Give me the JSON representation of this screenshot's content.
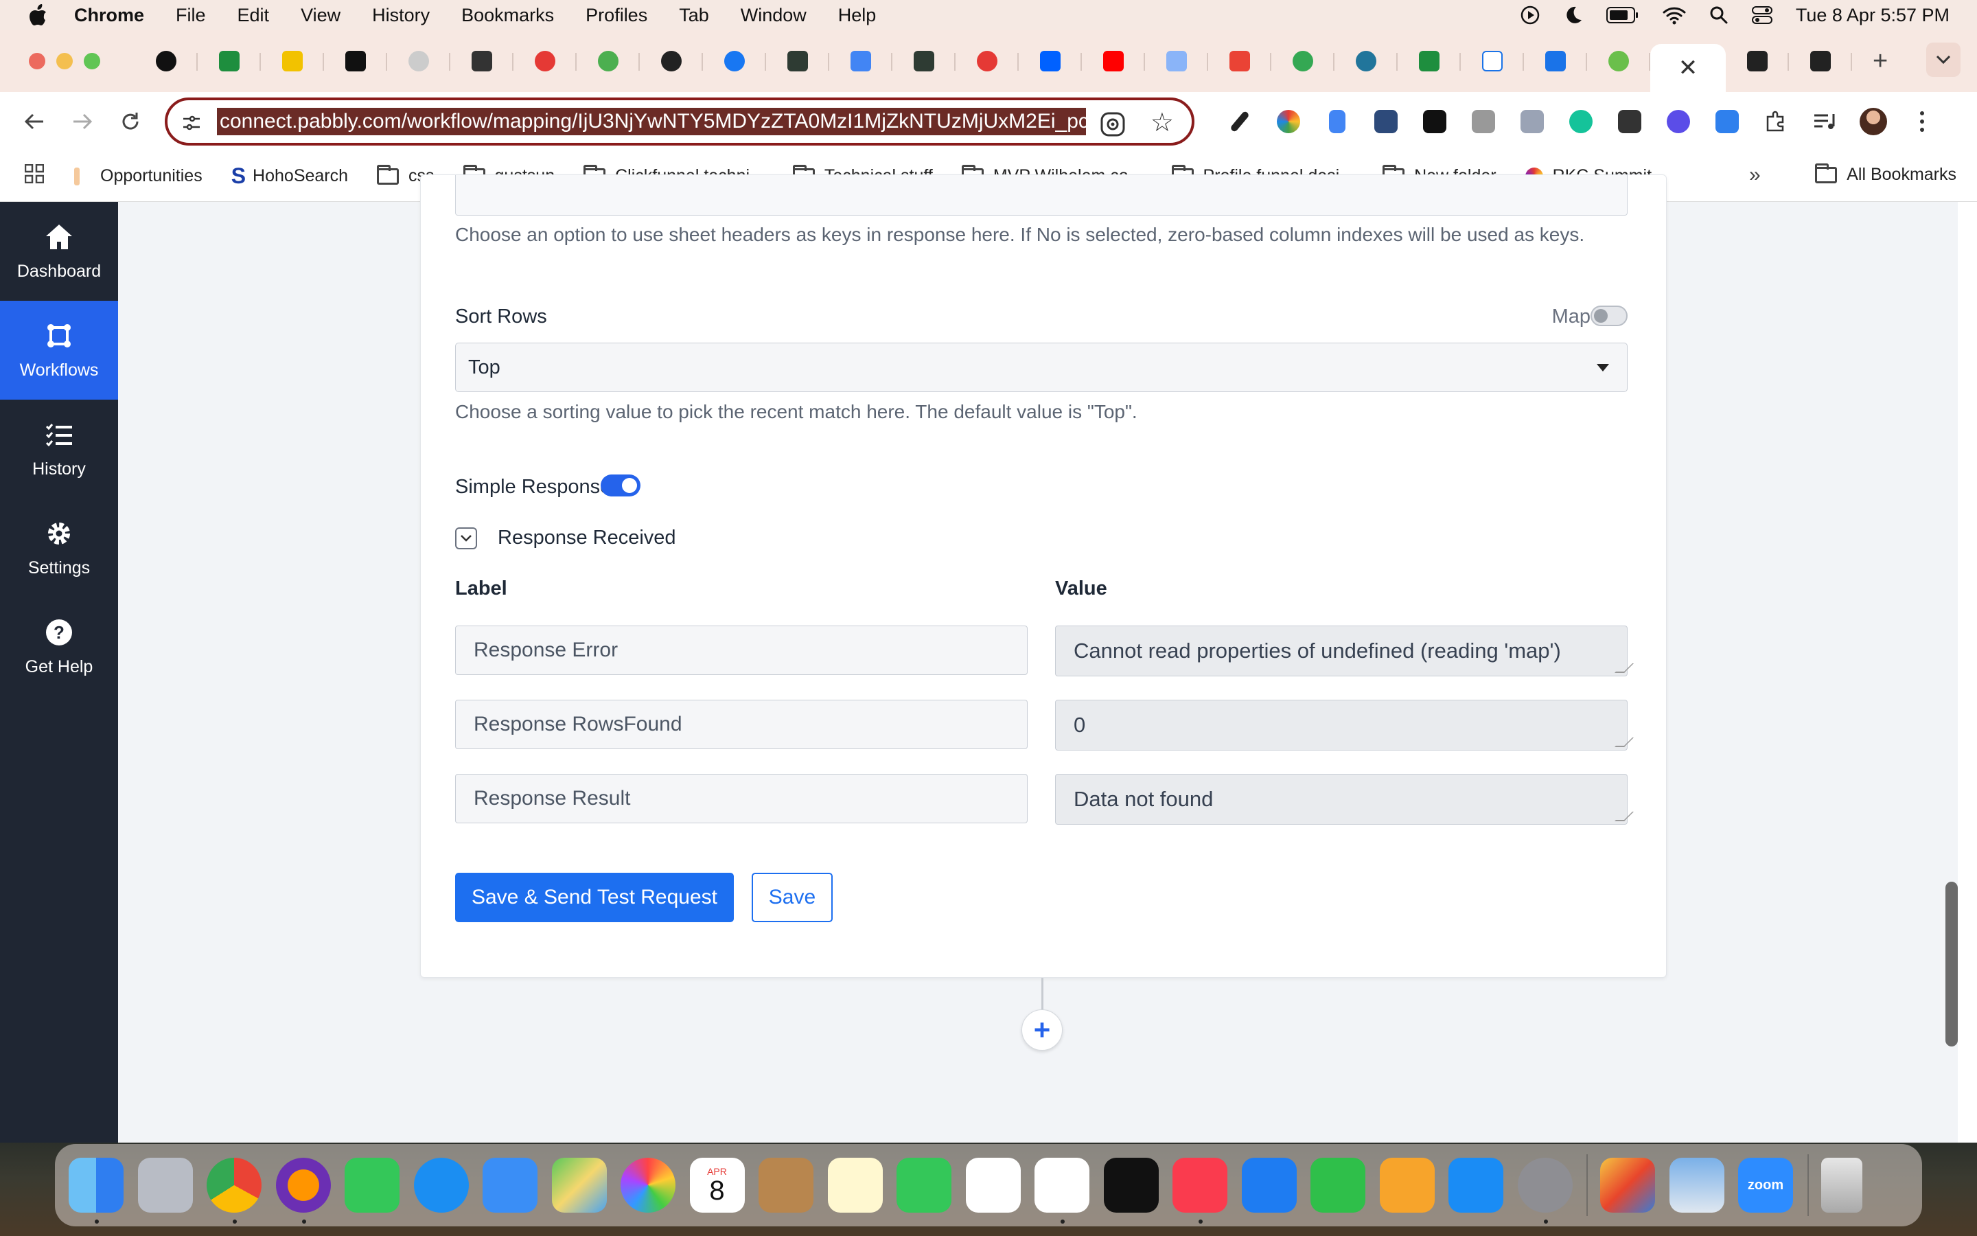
{
  "menubar": {
    "app": "Chrome",
    "items": [
      "File",
      "Edit",
      "View",
      "History",
      "Bookmarks",
      "Profiles",
      "Tab",
      "Window",
      "Help"
    ],
    "clock": "Tue 8 Apr  5:57 PM"
  },
  "browser": {
    "url": "connect.pabbly.com/workflow/mapping/IjU3NjYwNTY5MDYzZTA0MzI1MjZkNTUzMjUxM2Ei_pc",
    "bookmarks": [
      "Opportunities",
      "HohoSearch",
      "css",
      "gustsun",
      "Clickfunnel techni...",
      "Technical stuff",
      "MVP Wilhelem co...",
      "Profile funnel desi...",
      "New folder",
      "RKC Summit"
    ],
    "all_bookmarks": "All Bookmarks"
  },
  "sidebar": {
    "items": [
      {
        "label": "Dashboard",
        "icon": "home-icon"
      },
      {
        "label": "Workflows",
        "icon": "workflow-icon"
      },
      {
        "label": "History",
        "icon": "list-icon"
      },
      {
        "label": "Settings",
        "icon": "gear-icon"
      },
      {
        "label": "Get Help",
        "icon": "help-icon"
      }
    ],
    "active": "Workflows"
  },
  "form": {
    "headers_help": "Choose an option to use sheet headers as keys in response here. If No is selected, zero-based column indexes will be used as keys.",
    "sort_rows": {
      "label": "Sort Rows",
      "map_label": "Map",
      "map_enabled": false,
      "value": "Top",
      "help": "Choose a sorting value to pick the recent match here. The default value is \"Top\"."
    },
    "simple_response": {
      "label": "Simple Response",
      "enabled": true
    },
    "response_received": "Response Received",
    "columns": {
      "label": "Label",
      "value": "Value"
    },
    "rows": [
      {
        "label": "Response Error",
        "value": "Cannot read properties of undefined (reading 'map')"
      },
      {
        "label": "Response RowsFound",
        "value": "0"
      },
      {
        "label": "Response Result",
        "value": "Data not found"
      }
    ],
    "buttons": {
      "save_test": "Save & Send Test Request",
      "save": "Save"
    }
  },
  "dock": {
    "calendar_month": "APR",
    "calendar_day": "8",
    "zoom_label": "zoom"
  },
  "colors": {
    "accent": "#2563eb",
    "sidebar": "#1f2633",
    "chrome_frame": "#f7e8e2"
  }
}
